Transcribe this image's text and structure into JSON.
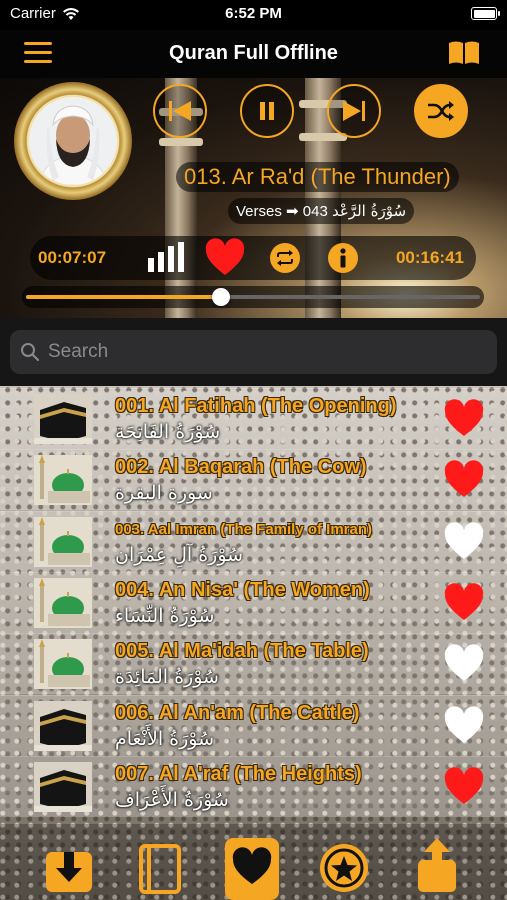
{
  "status_bar": {
    "carrier": "Carrier",
    "time": "6:52 PM"
  },
  "nav": {
    "title": "Quran Full Offline",
    "menu_icon": "hamburger-icon",
    "right_icon": "book-open-icon"
  },
  "player": {
    "track_title": "013. Ar Ra'd (The Thunder)",
    "verses_label": "Verses",
    "verses_count": "043",
    "verses_arabic": "سُوْرَةُ الرَّعْد",
    "elapsed": "00:07:07",
    "duration": "00:16:41",
    "progress": 0.43,
    "favorite": true,
    "accent": "#f5a623"
  },
  "search": {
    "placeholder": "Search"
  },
  "surahs": [
    {
      "title": "001. Al Fatihah (The Opening)",
      "arabic": "سُوْرَةُ الفَاتِحَة",
      "thumb": "kaaba",
      "favorite": true
    },
    {
      "title": "002. Al Baqarah (The Cow)",
      "arabic": "سورة البقرة",
      "thumb": "mosque",
      "favorite": true
    },
    {
      "title": "003. Aal Imran (The Family of Imran)",
      "arabic": "سُوْرَةُ آلِ عِمْرَان",
      "thumb": "mosque",
      "favorite": false
    },
    {
      "title": "004. An Nisa' (The Women)",
      "arabic": "سُوْرَةُ النِّسَاء",
      "thumb": "mosque",
      "favorite": true
    },
    {
      "title": "005. Al Ma'idah (The Table)",
      "arabic": "سُوْرَةُ المَائِدَة",
      "thumb": "mosque",
      "favorite": false
    },
    {
      "title": "006. Al An'am (The Cattle)",
      "arabic": "سُوْرَةُ الأَنْعَام",
      "thumb": "kaaba",
      "favorite": false
    },
    {
      "title": "007. Al A'raf (The Heights)",
      "arabic": "سُوْرَةُ الأَعْرَاف",
      "thumb": "kaaba",
      "favorite": true
    }
  ],
  "colors": {
    "heart_on": "#ff1a1a",
    "heart_off": "#ffffff",
    "title_text": "#f5a623"
  },
  "tabs": [
    {
      "icon": "download-icon",
      "active": false
    },
    {
      "icon": "book-icon",
      "active": false
    },
    {
      "icon": "heart-icon",
      "active": true
    },
    {
      "icon": "star-icon",
      "active": false
    },
    {
      "icon": "share-icon",
      "active": false
    }
  ]
}
